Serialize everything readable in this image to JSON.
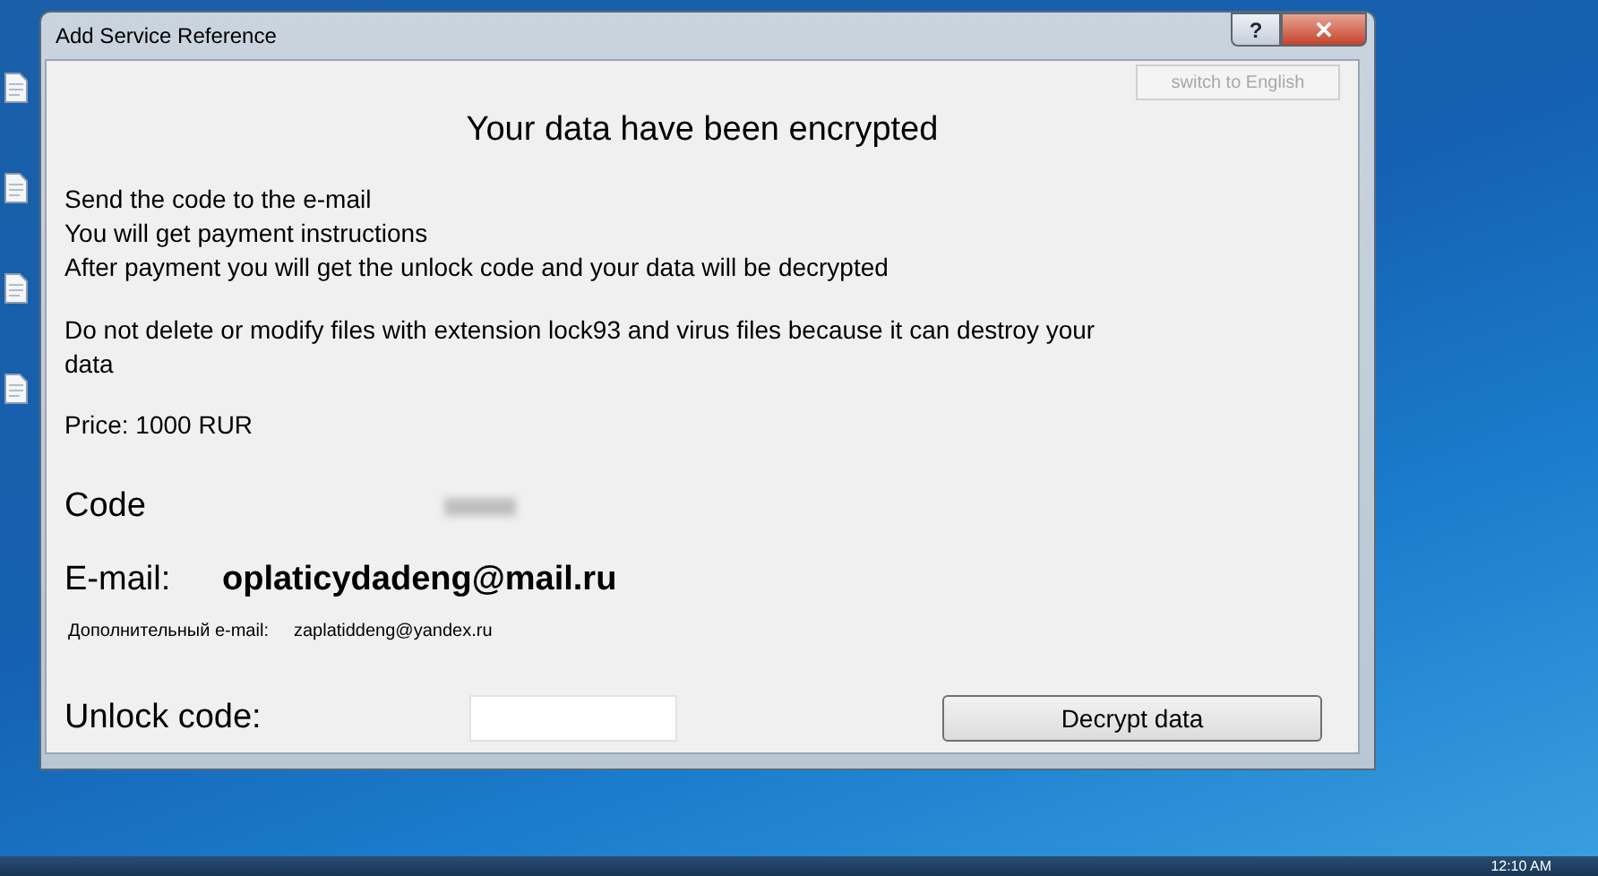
{
  "window": {
    "title": "Add Service Reference",
    "help_button": "?"
  },
  "language_button": {
    "label": "switch to English",
    "disabled": true
  },
  "heading": "Your data have been encrypted",
  "instructions": [
    "Send the code to the e-mail",
    "You will get payment instructions",
    "After payment you will get the unlock code and your data will be decrypted"
  ],
  "warning": "Do not delete or modify files with extension lock93 and virus files because it can destroy your data",
  "price": "Price: 1000 RUR",
  "code": {
    "label": "Code"
  },
  "email": {
    "label": "E-mail:",
    "value": "oplaticydadeng@mail.ru"
  },
  "extra_email": {
    "label": "Дополнительный e-mail:",
    "value": "zaplatiddeng@yandex.ru"
  },
  "unlock": {
    "label": "Unlock code:"
  },
  "decrypt_button": "Decrypt data",
  "taskbar": {
    "clock": "12:10 AM"
  }
}
